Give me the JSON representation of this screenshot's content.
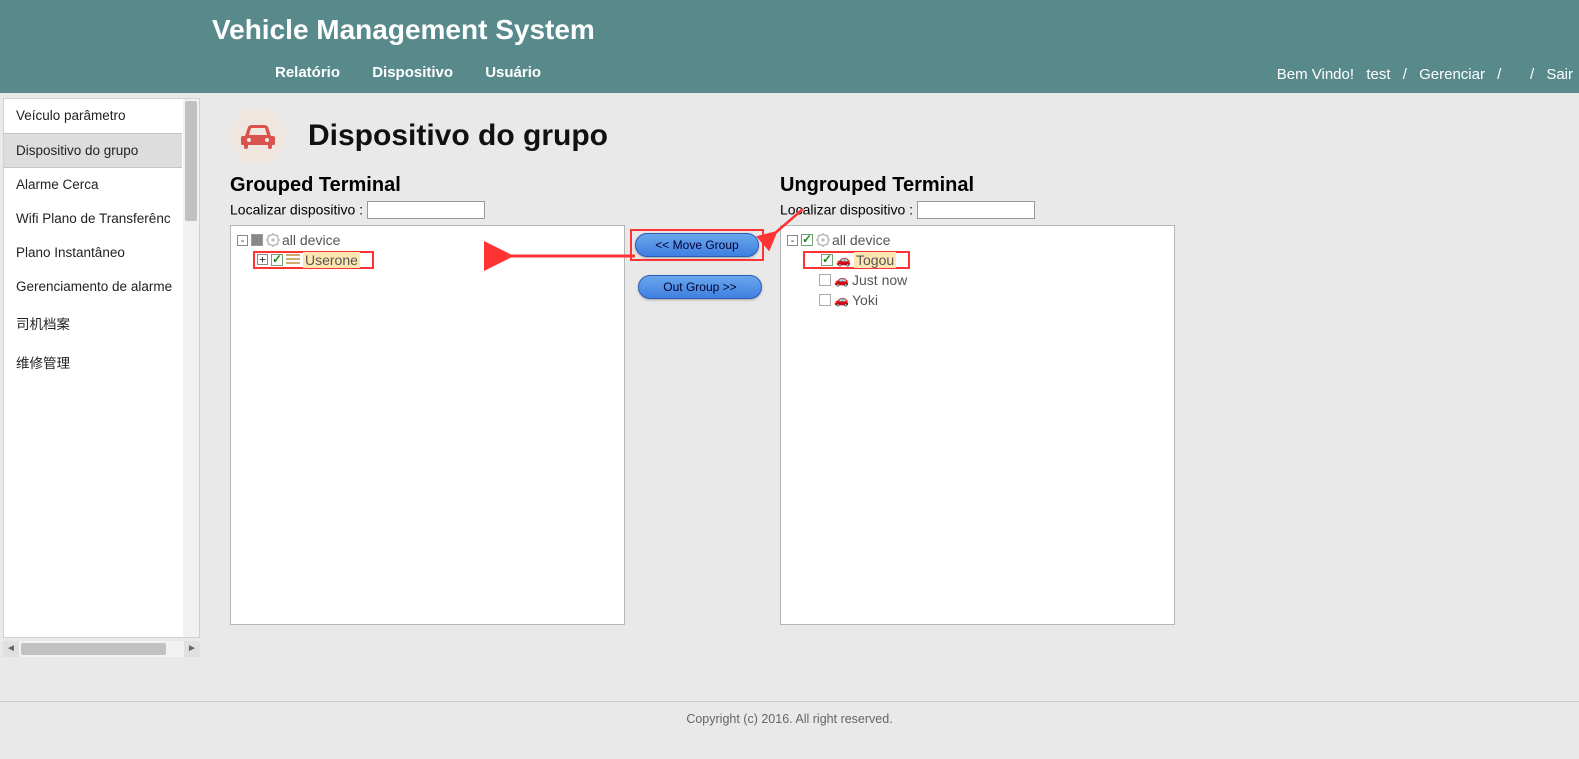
{
  "header": {
    "title": "Vehicle Management System",
    "nav": {
      "report": "Relatório",
      "device": "Dispositivo",
      "user": "Usuário"
    },
    "welcome": "Bem Vindo!",
    "username": "test",
    "manage": "Gerenciar",
    "logout": "Sair"
  },
  "sidebar": {
    "items": [
      "Veículo parâmetro",
      "Dispositivo do grupo",
      "Alarme Cerca",
      "Wifi Plano de Transferênc",
      "Plano Instantâneo",
      "Gerenciamento de alarme",
      "司机档案",
      "维修管理"
    ],
    "activeIndex": 1
  },
  "page": {
    "title": "Dispositivo do grupo",
    "grouped": {
      "heading": "Grouped Terminal",
      "search_label": "Localizar dispositivo :",
      "root": "all device",
      "user": "Userone"
    },
    "ungrouped": {
      "heading": "Ungrouped Terminal",
      "search_label": "Localizar dispositivo :",
      "root": "all device",
      "items": [
        "Togou",
        "Just now",
        "Yoki"
      ]
    },
    "actions": {
      "move": "<< Move Group",
      "out": "Out Group >>"
    }
  },
  "footer": "Copyright (c) 2016. All right reserved."
}
